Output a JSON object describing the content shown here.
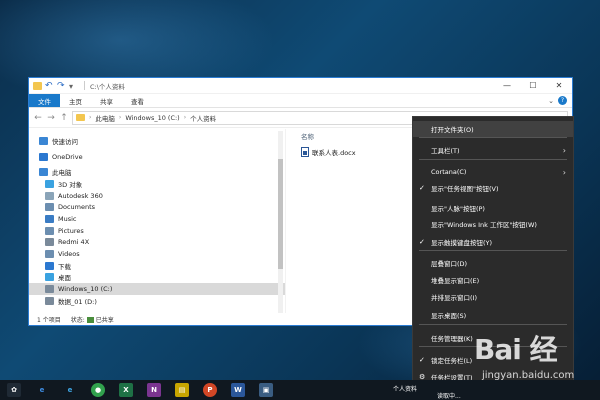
{
  "window": {
    "title_path": "C:\\个人资料",
    "controls": {
      "minimize": "—",
      "maximize": "☐",
      "close": "✕"
    }
  },
  "ribbon": {
    "tabs": [
      "文件",
      "主页",
      "共享",
      "查看"
    ],
    "help": "?"
  },
  "address": {
    "back": "←",
    "forward": "→",
    "up": "↑",
    "crumbs": [
      "此电脑",
      "Windows_10 (C:)",
      "个人资料"
    ]
  },
  "navpane": {
    "items": [
      {
        "label": "快速访问",
        "icon": "star-icon",
        "color": "#3a86d4"
      },
      {
        "label": "OneDrive",
        "icon": "cloud-icon",
        "color": "#2b78d0"
      },
      {
        "label": "此电脑",
        "icon": "computer-icon",
        "color": "#3a86d4"
      },
      {
        "label": "3D 对象",
        "icon": "cube-icon",
        "color": "#3aa2e0"
      },
      {
        "label": "Autodesk 360",
        "icon": "drive-icon",
        "color": "#8aa4b8"
      },
      {
        "label": "Documents",
        "icon": "documents-icon",
        "color": "#6c8eb0"
      },
      {
        "label": "Music",
        "icon": "music-icon",
        "color": "#3a7cc4"
      },
      {
        "label": "Pictures",
        "icon": "pictures-icon",
        "color": "#6c8eb0"
      },
      {
        "label": "Redmi 4X",
        "icon": "phone-icon",
        "color": "#7a8a9a"
      },
      {
        "label": "Videos",
        "icon": "video-icon",
        "color": "#6c8eb0"
      },
      {
        "label": "下载",
        "icon": "download-icon",
        "color": "#2b78d0"
      },
      {
        "label": "桌面",
        "icon": "desktop-icon",
        "color": "#3aa2e0"
      },
      {
        "label": "Windows_10 (C:)",
        "icon": "disk-icon",
        "color": "#7a8a9a",
        "selected": true
      },
      {
        "label": "数据_01 (D:)",
        "icon": "disk-icon",
        "color": "#7a8a9a"
      }
    ]
  },
  "content": {
    "column_header": "名称",
    "files": [
      {
        "name": "联系人表.docx",
        "icon": "word-doc-icon"
      }
    ]
  },
  "statusbar": {
    "count": "1 个项目",
    "state_label": "状态:",
    "state_value": "已共享"
  },
  "context_menu": {
    "items": [
      {
        "label": "打开文件夹(O)",
        "checked": false,
        "submenu": false
      },
      {
        "label": "工具栏(T)",
        "checked": false,
        "submenu": true
      },
      {
        "label": "Cortana(C)",
        "checked": false,
        "submenu": true
      },
      {
        "label": "显示\"任务视图\"按钮(V)",
        "checked": true,
        "submenu": false
      },
      {
        "label": "显示\"人脉\"按钮(P)",
        "checked": false,
        "submenu": false
      },
      {
        "label": "显示\"Windows Ink 工作区\"按钮(W)",
        "checked": false,
        "submenu": false
      },
      {
        "label": "显示触摸键盘按钮(Y)",
        "checked": true,
        "submenu": false
      },
      {
        "label": "层叠窗口(D)",
        "checked": false,
        "submenu": false
      },
      {
        "label": "堆叠显示窗口(E)",
        "checked": false,
        "submenu": false
      },
      {
        "label": "并排显示窗口(I)",
        "checked": false,
        "submenu": false
      },
      {
        "label": "显示桌面(S)",
        "checked": false,
        "submenu": false
      },
      {
        "label": "任务管理器(K)",
        "checked": false,
        "submenu": false
      },
      {
        "label": "锁定任务栏(L)",
        "checked": true,
        "submenu": false
      },
      {
        "label": "任务栏设置(T)",
        "checked": false,
        "submenu": false,
        "gear": true
      }
    ]
  },
  "taskbar": {
    "tray_text_1": "个人资料",
    "tray_text_2": "读取中..."
  },
  "watermark": {
    "big": "Bai 经",
    "small": "jingyan.baidu.com"
  }
}
